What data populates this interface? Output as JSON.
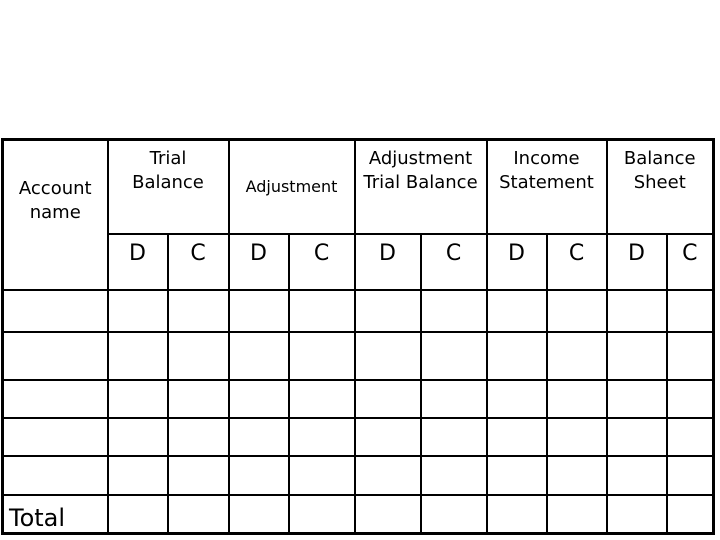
{
  "worksheet": {
    "account_header": "Account name",
    "groups": [
      {
        "label": "Trial Balance"
      },
      {
        "label": "Adjustment"
      },
      {
        "label": "Adjustment Trial Balance"
      },
      {
        "label": "Income Statement"
      },
      {
        "label": "Balance Sheet"
      }
    ],
    "debit_label": "D",
    "credit_label": "C",
    "total_label": "Total",
    "empty_rows": 5
  }
}
